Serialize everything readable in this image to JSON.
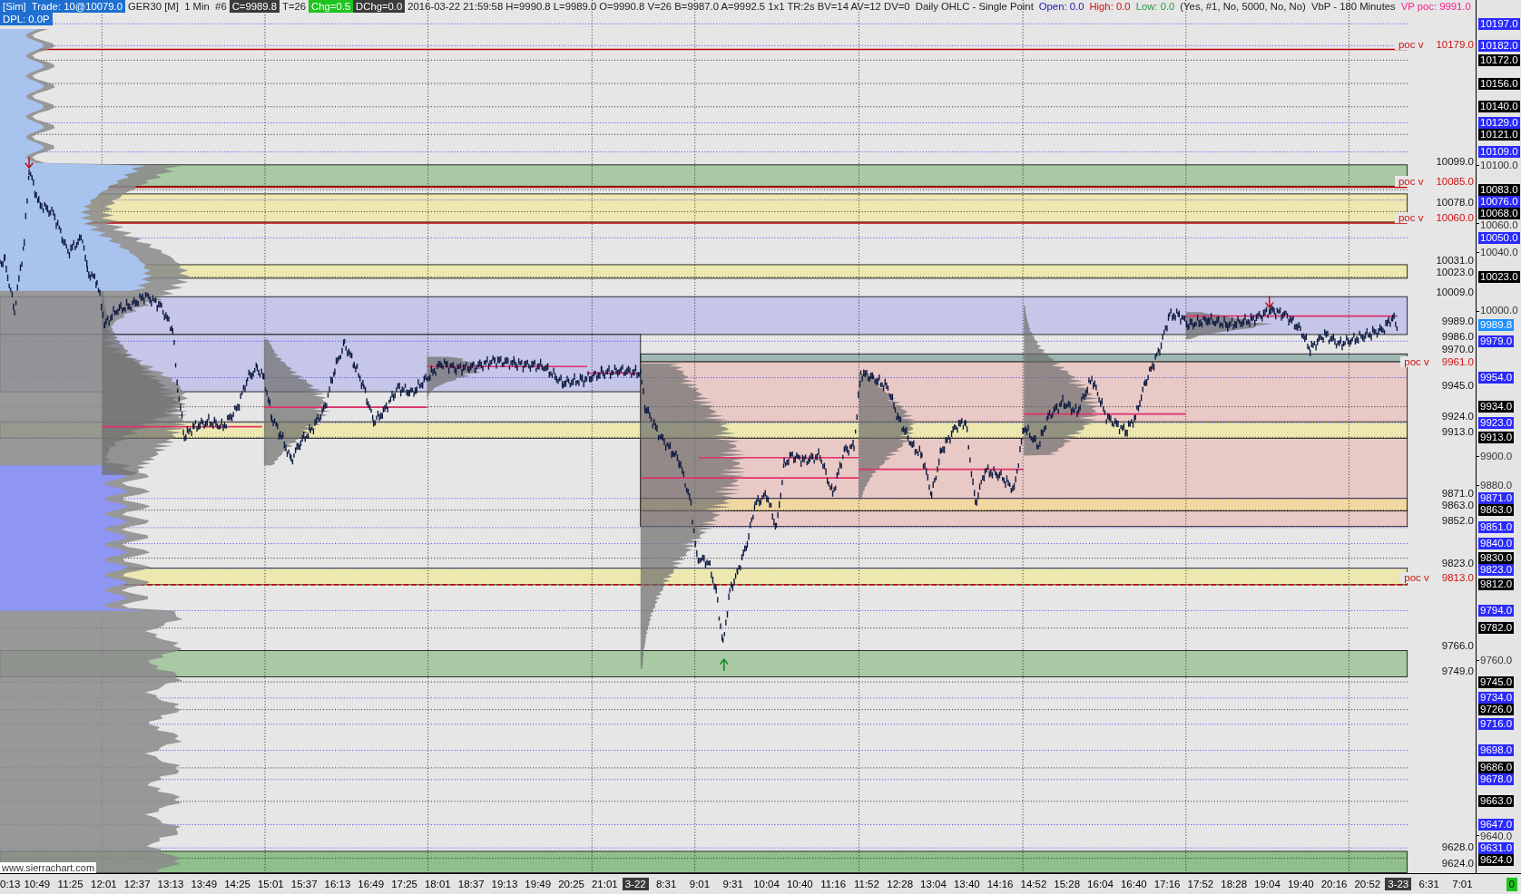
{
  "header": {
    "segments": [
      {
        "text": "[Sim]  Trade: 10@10079.0",
        "kind": "blue"
      },
      {
        "text": "GER30 [M]  1 Min  #6",
        "kind": "plain"
      },
      {
        "text": "C=9989.8",
        "kind": "dark"
      },
      {
        "text": "T=26",
        "kind": "plain"
      },
      {
        "text": "Chg=0.5",
        "kind": "green"
      },
      {
        "text": "DChg=0.0",
        "kind": "dark"
      },
      {
        "text": "2016-03-22 21:59:58 H=9990.8 L=9989.0 O=9990.8 V=26 B=9987.0 A=9992.5 1x1 TR:2s BV=14 AV=12 DV=0  Daily OHLC - Single Point",
        "kind": "plain"
      },
      {
        "text": "Open: 0.0",
        "kind": "blue_text"
      },
      {
        "text": "High: 0.0",
        "kind": "red_text"
      },
      {
        "text": "Low: 0.0",
        "kind": "green_text"
      },
      {
        "text": "(Yes, #1, No, 5000, No, No)  VbP - 180 Minutes",
        "kind": "plain"
      },
      {
        "text": "VP poc: 9991.0",
        "kind": "pink_text"
      }
    ],
    "second_line": {
      "text": "DPL: 0.0P",
      "kind": "blue"
    }
  },
  "chart": {
    "watermark_text": "www.sierrachart.com",
    "levels": [
      {
        "kind": "poc",
        "tag": "poc v",
        "price": "10179.0"
      },
      {
        "kind": "level",
        "price": "10099.0"
      },
      {
        "kind": "poc",
        "tag": "poc v",
        "price": "10085.0"
      },
      {
        "kind": "level",
        "price": "10078.0"
      },
      {
        "kind": "poc",
        "tag": "poc v",
        "price": "10060.0"
      },
      {
        "kind": "level",
        "price": "10031.0"
      },
      {
        "kind": "level",
        "price": "10023.0"
      },
      {
        "kind": "level",
        "price": "10009.0"
      },
      {
        "kind": "level",
        "price": "9989.0"
      },
      {
        "kind": "level",
        "price": "9986.0"
      },
      {
        "kind": "level",
        "price": "9970.0"
      },
      {
        "kind": "poc",
        "tag": "poc v",
        "price": "9961.0"
      },
      {
        "kind": "level",
        "price": "9945.0"
      },
      {
        "kind": "level",
        "price": "9924.0"
      },
      {
        "kind": "level",
        "price": "9913.0"
      },
      {
        "kind": "level",
        "price": "9871.0"
      },
      {
        "kind": "level",
        "price": "9863.0"
      },
      {
        "kind": "level",
        "price": "9852.0"
      },
      {
        "kind": "level",
        "price": "9823.0"
      },
      {
        "kind": "poc",
        "tag": "poc v",
        "price": "9813.0"
      },
      {
        "kind": "level",
        "price": "9766.0"
      },
      {
        "kind": "level",
        "price": "9749.0"
      },
      {
        "kind": "level",
        "price": "9628.0"
      },
      {
        "kind": "level",
        "price": "9624.0"
      }
    ]
  },
  "price_axis": [
    {
      "text": "10197.0",
      "kind": "blue"
    },
    {
      "text": "10182.0",
      "kind": "blue"
    },
    {
      "text": "10172.0",
      "kind": "black"
    },
    {
      "text": "10156.0",
      "kind": "black"
    },
    {
      "text": "10140.0",
      "kind": "black"
    },
    {
      "text": "10129.0",
      "kind": "blue"
    },
    {
      "text": "10121.0",
      "kind": "black"
    },
    {
      "text": "10109.0",
      "kind": "blue"
    },
    {
      "text": "10100.0",
      "kind": "tick"
    },
    {
      "text": "10083.0",
      "kind": "black"
    },
    {
      "text": "10076.0",
      "kind": "blue"
    },
    {
      "text": "10068.0",
      "kind": "black"
    },
    {
      "text": "10060.0",
      "kind": "tick"
    },
    {
      "text": "10050.0",
      "kind": "blue"
    },
    {
      "text": "10040.0",
      "kind": "tick"
    },
    {
      "text": "10023.0",
      "kind": "black"
    },
    {
      "text": "10000.0",
      "kind": "tick"
    },
    {
      "text": "9989.8",
      "kind": "last"
    },
    {
      "text": "9979.0",
      "kind": "blue"
    },
    {
      "text": "9954.0",
      "kind": "blue"
    },
    {
      "text": "9934.0",
      "kind": "black"
    },
    {
      "text": "9923.0",
      "kind": "blue"
    },
    {
      "text": "9913.0",
      "kind": "black"
    },
    {
      "text": "9900.0",
      "kind": "tick"
    },
    {
      "text": "9880.0",
      "kind": "tick"
    },
    {
      "text": "9871.0",
      "kind": "blue"
    },
    {
      "text": "9863.0",
      "kind": "black"
    },
    {
      "text": "9851.0",
      "kind": "blue"
    },
    {
      "text": "9840.0",
      "kind": "blue"
    },
    {
      "text": "9830.0",
      "kind": "black"
    },
    {
      "text": "9823.0",
      "kind": "blue"
    },
    {
      "text": "9812.0",
      "kind": "black"
    },
    {
      "text": "9794.0",
      "kind": "blue"
    },
    {
      "text": "9782.0",
      "kind": "black"
    },
    {
      "text": "9760.0",
      "kind": "tick"
    },
    {
      "text": "9745.0",
      "kind": "black"
    },
    {
      "text": "9734.0",
      "kind": "blue"
    },
    {
      "text": "9726.0",
      "kind": "black"
    },
    {
      "text": "9716.0",
      "kind": "blue"
    },
    {
      "text": "9698.0",
      "kind": "blue"
    },
    {
      "text": "9686.0",
      "kind": "black"
    },
    {
      "text": "9678.0",
      "kind": "blue"
    },
    {
      "text": "9663.0",
      "kind": "black"
    },
    {
      "text": "9647.0",
      "kind": "blue"
    },
    {
      "text": "9640.0",
      "kind": "tick"
    },
    {
      "text": "9631.0",
      "kind": "blue"
    },
    {
      "text": "9624.0",
      "kind": "black"
    }
  ],
  "time_axis": [
    {
      "text": "0:13",
      "kind": "time"
    },
    {
      "text": "10:49",
      "kind": "time"
    },
    {
      "text": "11:25",
      "kind": "time"
    },
    {
      "text": "12:01",
      "kind": "time"
    },
    {
      "text": "12:37",
      "kind": "time"
    },
    {
      "text": "13:13",
      "kind": "time"
    },
    {
      "text": "13:49",
      "kind": "time"
    },
    {
      "text": "14:25",
      "kind": "time"
    },
    {
      "text": "15:01",
      "kind": "time"
    },
    {
      "text": "15:37",
      "kind": "time"
    },
    {
      "text": "16:13",
      "kind": "time"
    },
    {
      "text": "16:49",
      "kind": "time"
    },
    {
      "text": "17:25",
      "kind": "time"
    },
    {
      "text": "18:01",
      "kind": "time"
    },
    {
      "text": "18:37",
      "kind": "time"
    },
    {
      "text": "19:13",
      "kind": "time"
    },
    {
      "text": "19:49",
      "kind": "time"
    },
    {
      "text": "20:25",
      "kind": "time"
    },
    {
      "text": "21:01",
      "kind": "time"
    },
    {
      "text": "3-22",
      "kind": "date"
    },
    {
      "text": "8:31",
      "kind": "time"
    },
    {
      "text": "9:01",
      "kind": "time"
    },
    {
      "text": "9:31",
      "kind": "time"
    },
    {
      "text": "10:04",
      "kind": "time"
    },
    {
      "text": "10:40",
      "kind": "time"
    },
    {
      "text": "11:16",
      "kind": "time"
    },
    {
      "text": "11:52",
      "kind": "time"
    },
    {
      "text": "12:28",
      "kind": "time"
    },
    {
      "text": "13:04",
      "kind": "time"
    },
    {
      "text": "13:40",
      "kind": "time"
    },
    {
      "text": "14:16",
      "kind": "time"
    },
    {
      "text": "14:52",
      "kind": "time"
    },
    {
      "text": "15:28",
      "kind": "time"
    },
    {
      "text": "16:04",
      "kind": "time"
    },
    {
      "text": "16:40",
      "kind": "time"
    },
    {
      "text": "17:16",
      "kind": "time"
    },
    {
      "text": "17:52",
      "kind": "time"
    },
    {
      "text": "18:28",
      "kind": "time"
    },
    {
      "text": "19:04",
      "kind": "time"
    },
    {
      "text": "19:40",
      "kind": "time"
    },
    {
      "text": "20:16",
      "kind": "time"
    },
    {
      "text": "20:52",
      "kind": "time"
    },
    {
      "text": "3-23",
      "kind": "date"
    },
    {
      "text": "6:31",
      "kind": "time"
    },
    {
      "text": "7:01",
      "kind": "time"
    }
  ],
  "status_badge": "0"
}
